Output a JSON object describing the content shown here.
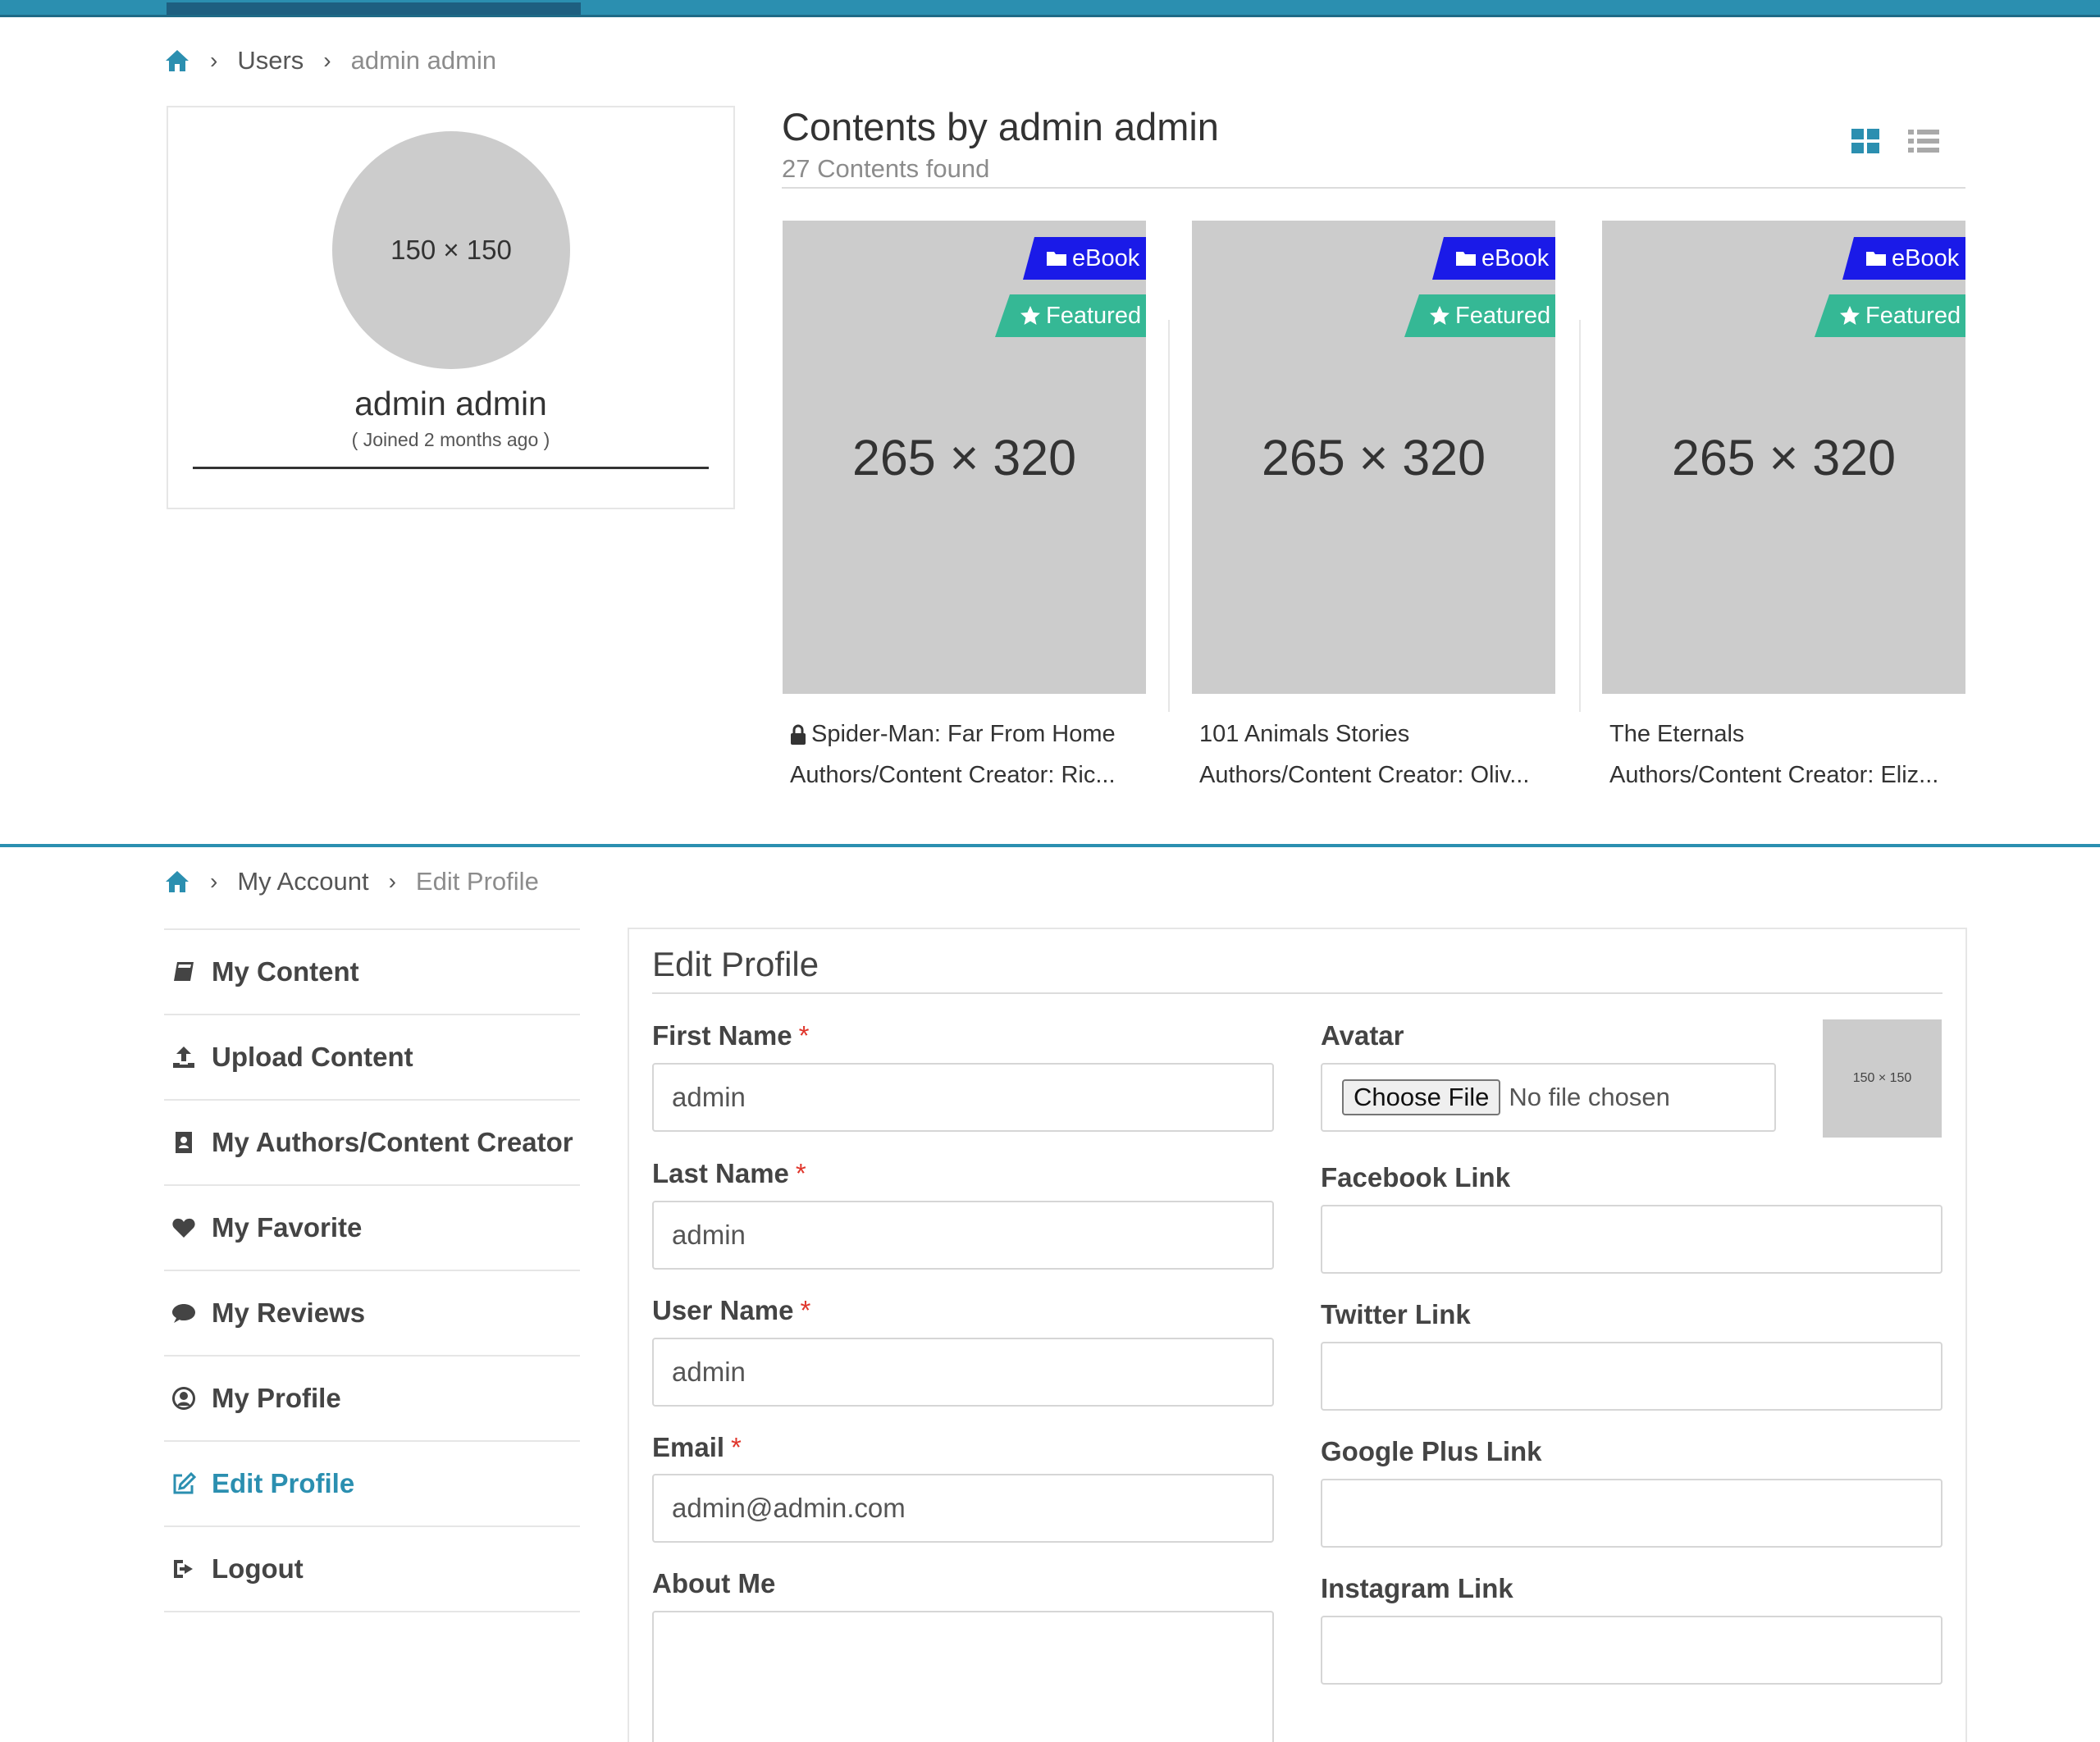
{
  "breadcrumb_top": {
    "items": [
      "Users"
    ],
    "current": "admin admin"
  },
  "profile": {
    "avatar_placeholder": "150 × 150",
    "name": "admin admin",
    "joined": "( Joined 2 months ago )"
  },
  "contents": {
    "title": "Contents by admin admin",
    "count": "27 Contents found",
    "view_modes": [
      "grid-view-icon",
      "list-view-icon"
    ],
    "cards": [
      {
        "thumb": "265 × 320",
        "badge_type": "eBook",
        "badge_featured": "Featured",
        "locked": true,
        "title": "Spider-Man: Far From Home",
        "author": "Authors/Content Creator: Ric..."
      },
      {
        "thumb": "265 × 320",
        "badge_type": "eBook",
        "badge_featured": "Featured",
        "locked": false,
        "title": "101 Animals Stories",
        "author": "Authors/Content Creator: Oliv..."
      },
      {
        "thumb": "265 × 320",
        "badge_type": "eBook",
        "badge_featured": "Featured",
        "locked": false,
        "title": "The Eternals",
        "author": "Authors/Content Creator: Eliz..."
      }
    ]
  },
  "breadcrumb_bottom": {
    "items": [
      "My Account"
    ],
    "current": "Edit Profile"
  },
  "side_menu": {
    "items": [
      {
        "label": "My Content",
        "icon": "book-icon"
      },
      {
        "label": "Upload Content",
        "icon": "upload-icon"
      },
      {
        "label": "My Authors/Content Creator",
        "icon": "address-book-icon"
      },
      {
        "label": "My Favorite",
        "icon": "heart-icon"
      },
      {
        "label": "My Reviews",
        "icon": "comment-icon"
      },
      {
        "label": "My Profile",
        "icon": "user-circle-icon"
      },
      {
        "label": "Edit Profile",
        "icon": "edit-icon",
        "active": true
      },
      {
        "label": "Logout",
        "icon": "logout-icon"
      }
    ]
  },
  "edit_profile": {
    "title": "Edit Profile",
    "required_mark": "*",
    "first_name": {
      "label": "First Name",
      "value": "admin"
    },
    "last_name": {
      "label": "Last Name",
      "value": "admin"
    },
    "user_name": {
      "label": "User Name",
      "value": "admin"
    },
    "email": {
      "label": "Email",
      "value": "admin@admin.com"
    },
    "about": {
      "label": "About Me",
      "value": ""
    },
    "avatar": {
      "label": "Avatar",
      "button": "Choose File",
      "status": "No file chosen",
      "preview": "150 × 150"
    },
    "facebook": {
      "label": "Facebook Link",
      "value": ""
    },
    "twitter": {
      "label": "Twitter Link",
      "value": ""
    },
    "google": {
      "label": "Google Plus Link",
      "value": ""
    },
    "instagram": {
      "label": "Instagram Link",
      "value": ""
    }
  },
  "colors": {
    "accent": "#2b8fb0",
    "ebook_badge": "#1a1ae8",
    "featured_badge": "#35b895",
    "required": "#e0352b",
    "placeholder_gray": "#cccccc"
  }
}
